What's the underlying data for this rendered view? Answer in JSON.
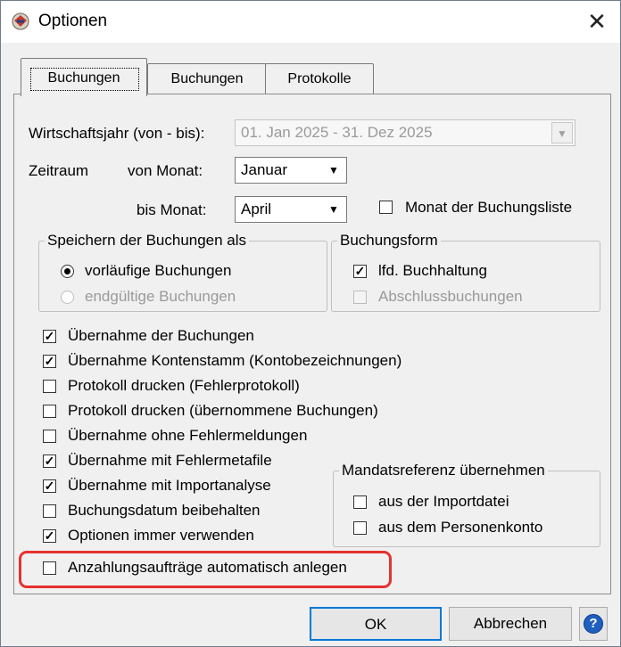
{
  "window": {
    "title": "Optionen",
    "close_glyph": "✕",
    "app_icon": "app-icon"
  },
  "tabs": [
    {
      "label": "Buchungen",
      "active": true
    },
    {
      "label": "Buchungen",
      "active": false
    },
    {
      "label": "Protokolle",
      "active": false
    }
  ],
  "fiscal_year": {
    "label": "Wirtschaftsjahr (von - bis):",
    "value": "01. Jan 2025  -  31. Dez 2025",
    "enabled": false
  },
  "period": {
    "label": "Zeitraum",
    "from_label": "von  Monat:",
    "from_value": "Januar",
    "to_label": "bis   Monat:",
    "to_value": "April",
    "booking_list_month": {
      "label": "Monat der Buchungsliste",
      "checked": false
    }
  },
  "save_group": {
    "legend": "Speichern der Buchungen als",
    "options": [
      {
        "label": "vorläufige Buchungen",
        "selected": true,
        "enabled": true
      },
      {
        "label": "endgültige Buchungen",
        "selected": false,
        "enabled": false
      }
    ]
  },
  "form_group": {
    "legend": "Buchungsform",
    "options": [
      {
        "label": "lfd. Buchhaltung",
        "checked": true,
        "enabled": true
      },
      {
        "label": "Abschlussbuchungen",
        "checked": false,
        "enabled": false
      }
    ]
  },
  "options": [
    {
      "label": "Übernahme der Buchungen",
      "checked": true
    },
    {
      "label": "Übernahme Kontenstamm (Kontobezeichnungen)",
      "checked": true
    },
    {
      "label": "Protokoll drucken (Fehlerprotokoll)",
      "checked": false
    },
    {
      "label": "Protokoll drucken (übernommene Buchungen)",
      "checked": false
    },
    {
      "label": "Übernahme ohne Fehlermeldungen",
      "checked": false
    },
    {
      "label": "Übernahme mit Fehlermetafile",
      "checked": true
    },
    {
      "label": "Übernahme mit Importanalyse",
      "checked": true
    },
    {
      "label": "Buchungsdatum beibehalten",
      "checked": false
    },
    {
      "label": "Optionen immer verwenden",
      "checked": true
    },
    {
      "label": "Anzahlungsaufträge automatisch anlegen",
      "checked": false
    }
  ],
  "mandate_group": {
    "legend": "Mandatsreferenz übernehmen",
    "options": [
      {
        "label": "aus der Importdatei",
        "checked": false
      },
      {
        "label": "aus dem Personenkonto",
        "checked": false
      }
    ]
  },
  "buttons": {
    "ok": "OK",
    "cancel": "Abbrechen",
    "help_glyph": "?"
  },
  "colors": {
    "highlight": "#e5312f",
    "default_button_border": "#0078d7",
    "disabled_text": "#9a9a9a"
  }
}
